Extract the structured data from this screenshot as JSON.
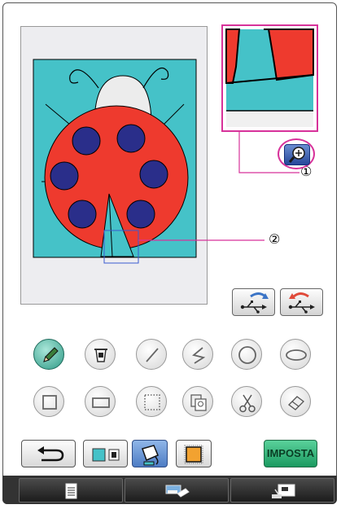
{
  "callouts": {
    "one": "①",
    "two": "②"
  },
  "buttons": {
    "imposta_label": "IMPOSTA",
    "zoom_icon": "magnifier-plus-icon",
    "usb_import_icon": "usb-import-icon",
    "usb_export_icon": "usb-export-icon"
  },
  "tools": [
    {
      "name": "pencil-tool",
      "icon": "pencil-icon",
      "selected": true
    },
    {
      "name": "fill-tool",
      "icon": "paint-bucket-icon"
    },
    {
      "name": "line-tool",
      "icon": "line-icon"
    },
    {
      "name": "polyline-tool",
      "icon": "polyline-icon"
    },
    {
      "name": "circle-tool",
      "icon": "circle-icon"
    },
    {
      "name": "ellipse-tool",
      "icon": "ellipse-icon"
    },
    {
      "name": "square-tool",
      "icon": "square-icon"
    },
    {
      "name": "rectangle-tool",
      "icon": "rectangle-icon"
    },
    {
      "name": "select-area-tool",
      "icon": "dotted-selection-icon"
    },
    {
      "name": "copy-tool",
      "icon": "copy-icon"
    },
    {
      "name": "cut-tool",
      "icon": "scissors-icon"
    },
    {
      "name": "eraser-tool",
      "icon": "eraser-icon"
    }
  ],
  "colors": {
    "background_cyan": "#45c2c8",
    "ladybug_red": "#ee3a2e",
    "spots_navy": "#2a2e8a",
    "head_white": "#ececec",
    "highlight_magenta": "#d7329a",
    "imposta_green": "#1a9a60"
  },
  "tabs": [
    {
      "icon": "document-icon"
    },
    {
      "icon": "brush-eraser-icon"
    },
    {
      "icon": "sewing-machine-icon"
    }
  ]
}
